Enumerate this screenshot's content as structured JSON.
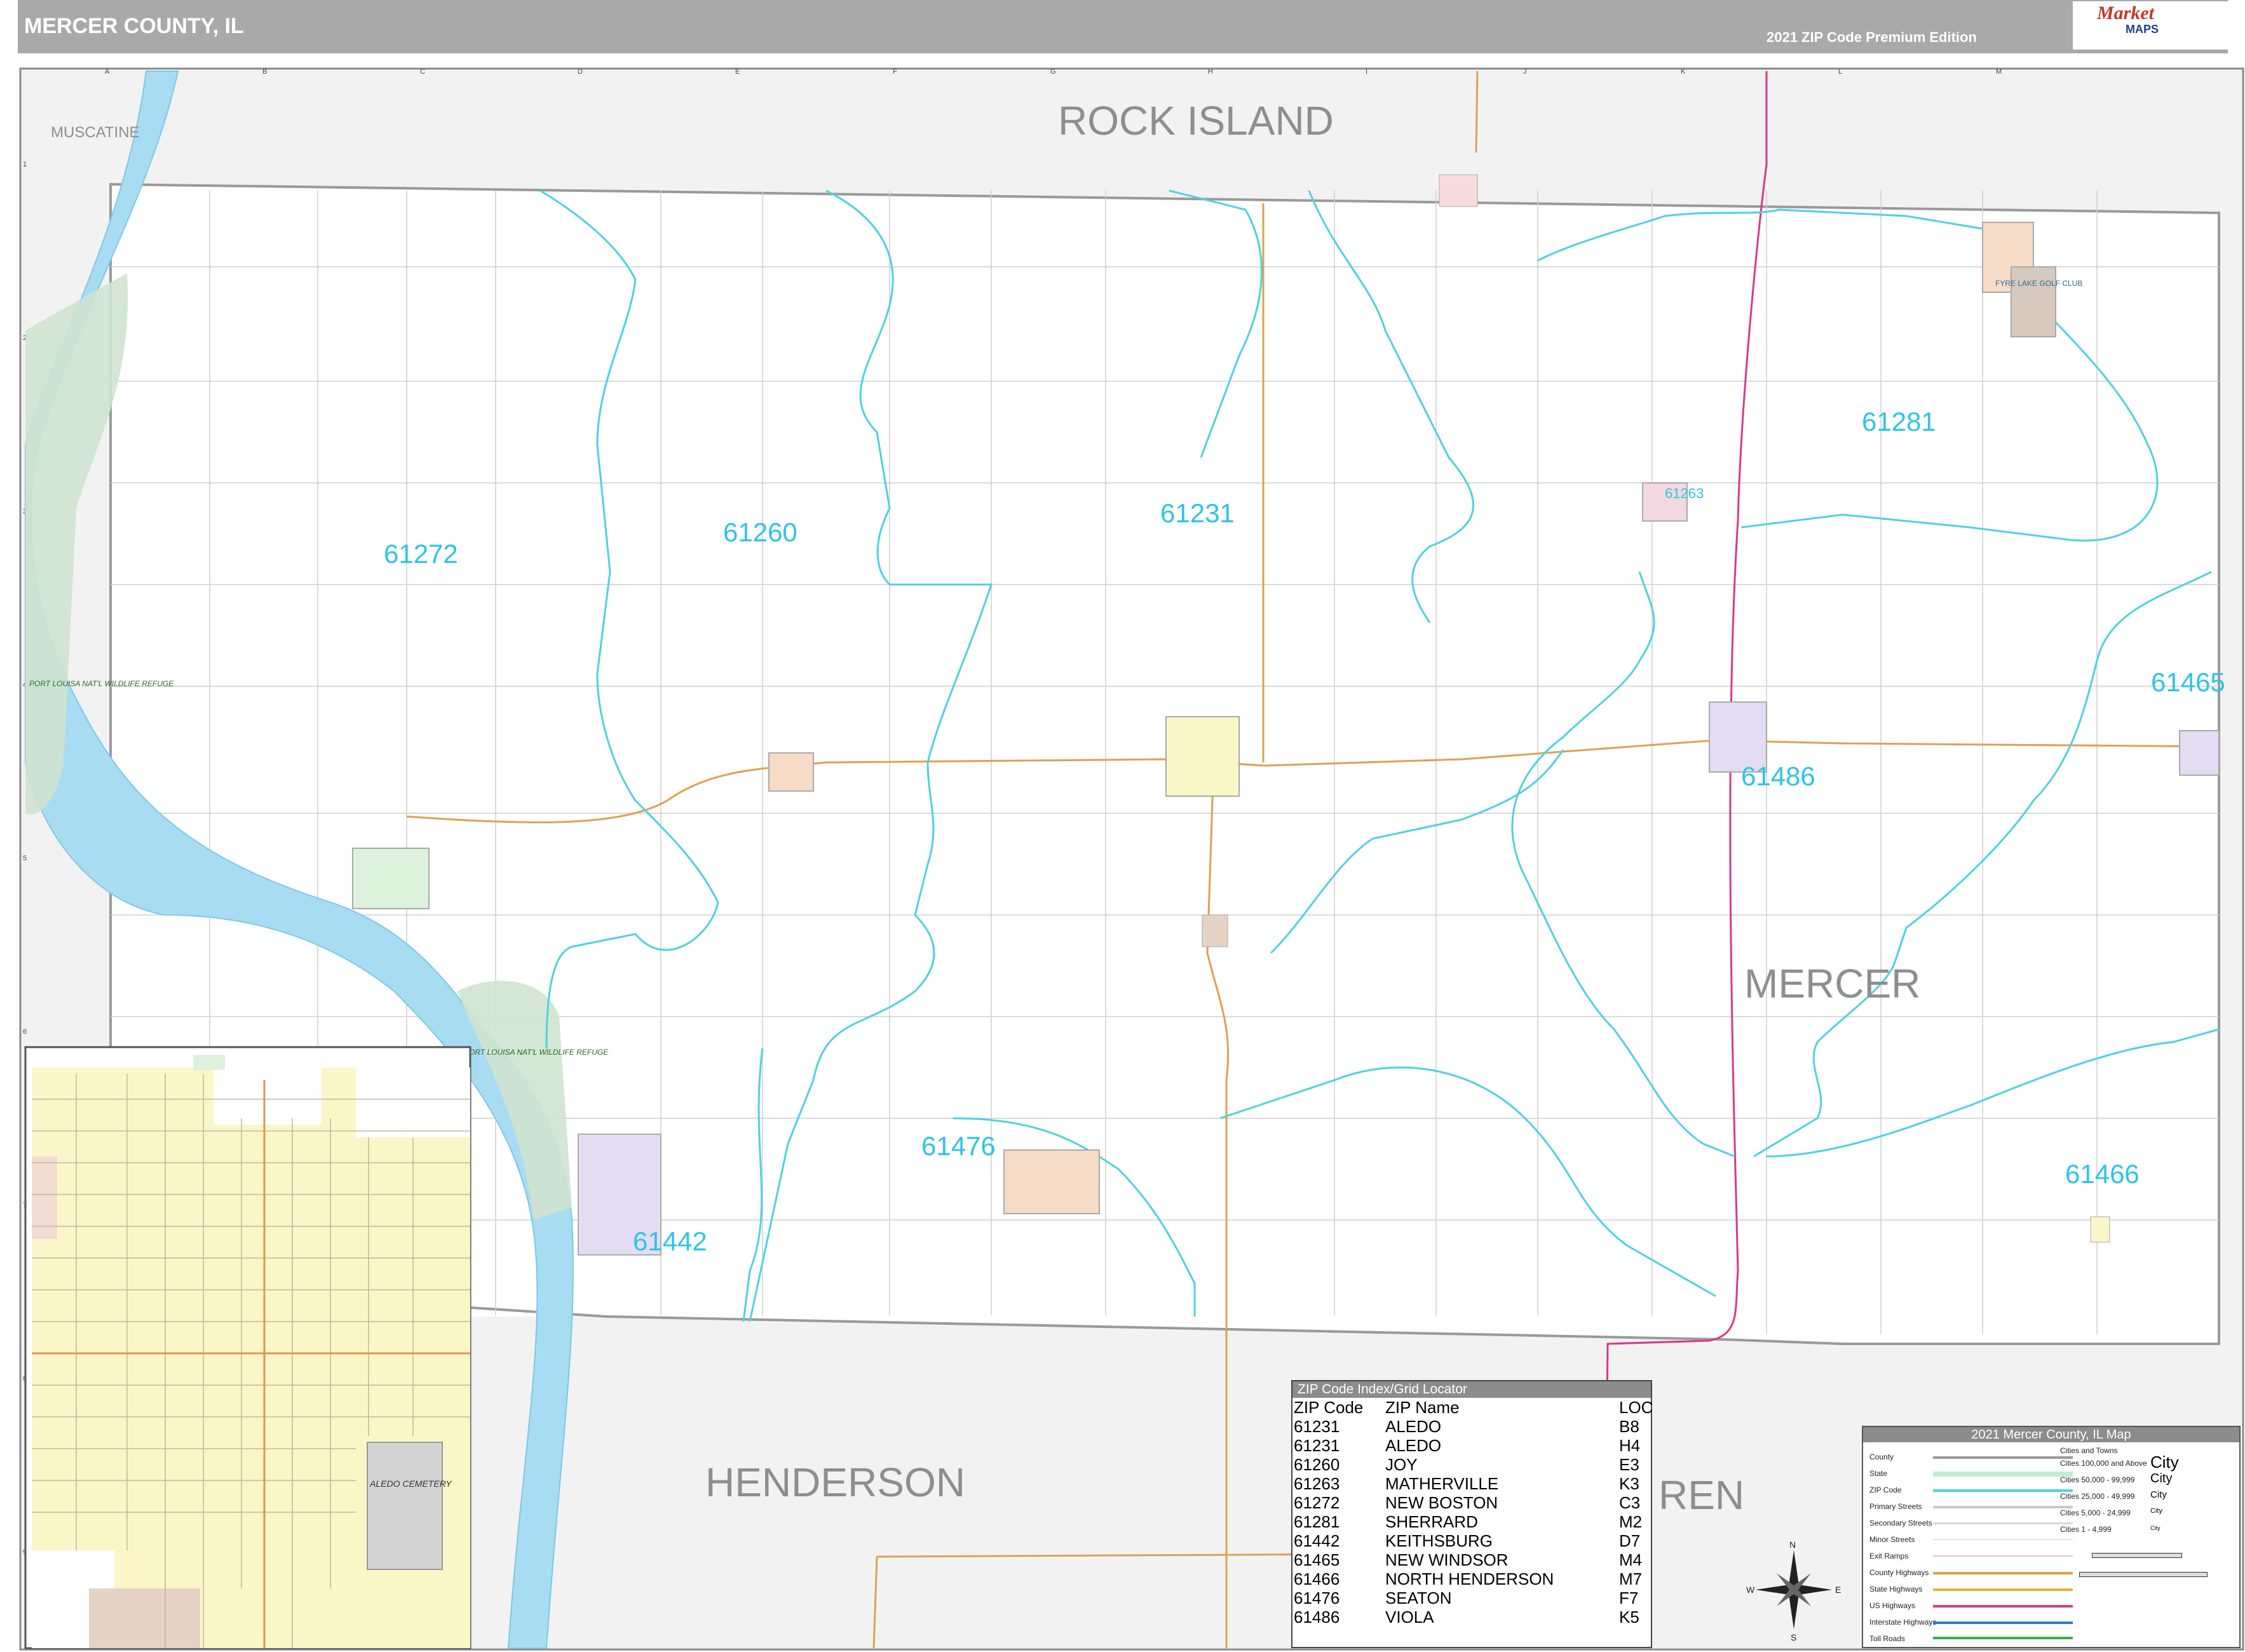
{
  "header": {
    "title": "MERCER COUNTY, IL",
    "edition": "2021 ZIP Code Premium Edition",
    "logo_word1": "Market",
    "logo_word2": "MAPS"
  },
  "colors": {
    "zip_boundary": "#4fd1e0",
    "zip_label": "#2ec4e6",
    "county_outside": "#f2f2f2",
    "river": "#a8dcf2",
    "refuge": "#cfe3cf",
    "state_highway": "#e0a050",
    "interstate": "#d63a8a",
    "inset_fill": "#fbf6c8"
  },
  "neighbor_labels": [
    "ROCK ISLAND",
    "MUSCATINE",
    "MERCER",
    "HENDERSON",
    "REN"
  ],
  "zip_labels": [
    "61272",
    "61260",
    "61231",
    "61281",
    "61263",
    "61465",
    "61486",
    "61476",
    "61442",
    "61466"
  ],
  "refuge_label": "PORT LOUISA NAT'L WILDLIFE REFUGE",
  "golf_label": "FYRE LAKE GOLF CLUB",
  "cemetery_label": "ALEDO CEMETERY",
  "index_table": {
    "title": "ZIP Code Index/Grid Locator",
    "headers": [
      "ZIP Code",
      "ZIP Name",
      "LOC"
    ],
    "rows": [
      [
        "61231",
        "ALEDO",
        "B8"
      ],
      [
        "61231",
        "ALEDO",
        "H4"
      ],
      [
        "61260",
        "JOY",
        "E3"
      ],
      [
        "61263",
        "MATHERVILLE",
        "K3"
      ],
      [
        "61272",
        "NEW BOSTON",
        "C3"
      ],
      [
        "61281",
        "SHERRARD",
        "M2"
      ],
      [
        "61442",
        "KEITHSBURG",
        "D7"
      ],
      [
        "61465",
        "NEW WINDSOR",
        "M4"
      ],
      [
        "61466",
        "NORTH HENDERSON",
        "M7"
      ],
      [
        "61476",
        "SEATON",
        "F7"
      ],
      [
        "61486",
        "VIOLA",
        "K5"
      ]
    ]
  },
  "legend": {
    "title": "2021 Mercer County, IL Map",
    "items": [
      "County",
      "State",
      "ZIP Code",
      "Primary Streets",
      "Secondary Streets",
      "Minor Streets",
      "Exit Ramps",
      "County Highways",
      "State Highways",
      "US Highways",
      "Interstate Highways",
      "Toll Roads"
    ],
    "cities_header": "Cities and Towns",
    "city_classes": [
      "Cities 100,000 and Above",
      "Cities 50,000 - 99,999",
      "Cities 25,000 - 49,999",
      "Cities 5,000 - 24,999",
      "Cities 1 - 4,999"
    ],
    "city_symbol": "City"
  },
  "compass": {
    "n": "N",
    "s": "S",
    "e": "E",
    "w": "W"
  },
  "grid": {
    "columns": [
      "A",
      "B",
      "C",
      "D",
      "E",
      "F",
      "G",
      "H",
      "I",
      "J",
      "K",
      "L",
      "M"
    ],
    "rows": [
      "1",
      "2",
      "3",
      "4",
      "5",
      "6",
      "7",
      "8",
      "9"
    ]
  }
}
